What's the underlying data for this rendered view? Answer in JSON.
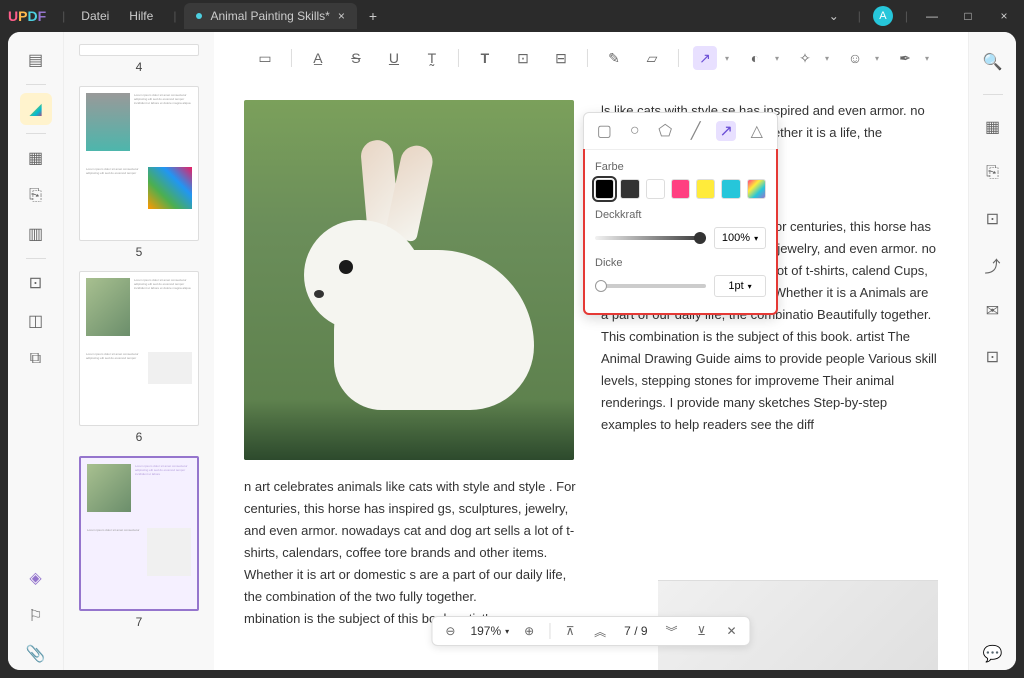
{
  "app": {
    "logo_u": "U",
    "logo_p": "P",
    "logo_d": "D",
    "logo_f": "F"
  },
  "menu": {
    "file": "Datei",
    "help": "Hilfe"
  },
  "tab": {
    "title": "Animal Painting Skills*",
    "close": "×",
    "add": "+"
  },
  "avatar": {
    "initial": "A"
  },
  "window": {
    "down": "⌄",
    "min": "—",
    "max": "□",
    "close": "×"
  },
  "thumbs": {
    "p4": "4",
    "p5": "5",
    "p6": "6",
    "p7": "7"
  },
  "popup": {
    "color_label": "Farbe",
    "opacity_label": "Deckkraft",
    "opacity_value": "100%",
    "thickness_label": "Dicke",
    "thickness_value": "1pt",
    "colors": [
      "#000000",
      "#333333",
      "#ffffff",
      "#ff4081",
      "#ffeb3b",
      "#26c6da",
      "linear-gradient(135deg,#ff4081,#ffeb3b,#26c6da,#9575cd)"
    ]
  },
  "pager": {
    "zoom": "197%",
    "pages": "7 / 9"
  },
  "body_text_left": "n art celebrates animals like cats with style and style . For centuries, this horse has inspired gs, sculptures, jewelry, and even armor. nowadays cat and dog art sells a lot of t-shirts, calendars, coffee tore brands and other items. Whether it is art or domestic s are a part of our daily life, the combination of the two fully together.\nmbination is the subject of this book. artist's",
  "body_text_right_top": "ls like cats with style se has inspired and even armor. no ot of t-shirts, calend tems. Whether it is a life, the combinatio",
  "body_text_right": "ls like cats with style beauty. For centuries, this horse has inspired Paintings, sculptures, jewelry, and even armor. no Times, cat and dog art sells a lot of t-shirts, calend Cups, store brands and other items. Whether it is a Animals are a part of our daily life, the combinatio Beautifully together.\nThis combination is the subject of this book. artist The Animal Drawing Guide aims to provide people Various skill levels, stepping stones for improveme Their animal renderings. I provide many sketches Step-by-step examples to help readers see the diff"
}
